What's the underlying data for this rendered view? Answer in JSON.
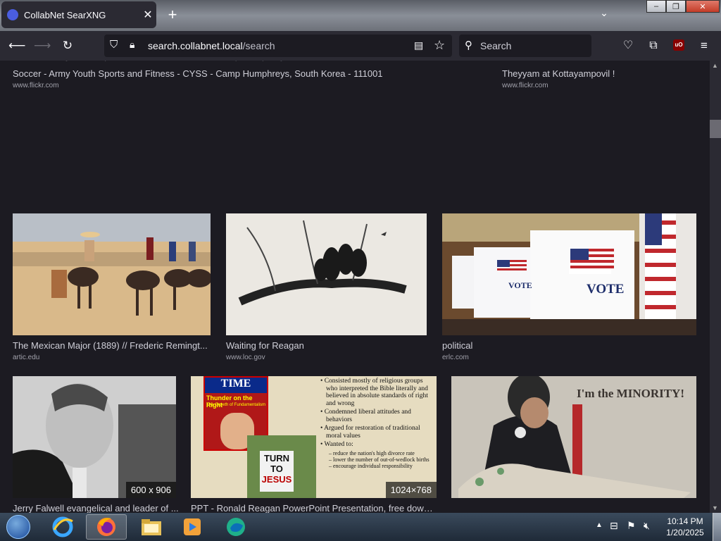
{
  "browser": {
    "tab_title": "CollabNet SearXNG",
    "url_host": "search.collabnet.local",
    "url_path": "/search",
    "search_placeholder": "Search",
    "ub_label": "uO"
  },
  "results": {
    "row1": [
      {
        "caption": "Soccer - Army Youth Sports and Fitness - CYSS - Camp Humphreys, South Korea - 111001",
        "source": "www.flickr.com"
      },
      {
        "caption": "Theyyam at Kottayampovil !",
        "source": "www.flickr.com"
      }
    ],
    "row2": [
      {
        "caption": "The Mexican Major (1889) // Frederic Remingt...",
        "source": "artic.edu"
      },
      {
        "caption": "Waiting for Reagan",
        "source": "www.loc.gov"
      },
      {
        "caption": "political",
        "source": "erlc.com"
      }
    ],
    "row3": [
      {
        "caption": "Jerry Falwell evangelical and leader of ...",
        "dimensions": "600 x 906"
      },
      {
        "caption": "PPT - Ronald Reagan PowerPoint Presentation, free downl...",
        "dimensions": "1024×768"
      },
      {
        "caption": "",
        "dimensions": ""
      }
    ]
  },
  "image_text": {
    "vote": "VOTE",
    "time_mag": "TIME",
    "time_headline": "Thunder on the Right",
    "time_sub": "The Growth of Fundamentalism",
    "turn_sign_1": "TURN",
    "turn_sign_2": "TO",
    "turn_sign_3": "JESUS",
    "minority": "I'm the MINORITY!",
    "slide_bullets": [
      "Consisted mostly of religious groups who interpreted the Bible literally and believed in absolute standards of right and wrong",
      "Condemned liberal attitudes and behaviors",
      "Argued for restoration of traditional moral values",
      "Wanted to:"
    ],
    "slide_subbullets": [
      "reduce the nation's high divorce rate",
      "lower the number of out-of-wedlock births",
      "encourage individual responsibility"
    ]
  },
  "taskbar": {
    "time": "10:14 PM",
    "date": "1/20/2025"
  }
}
